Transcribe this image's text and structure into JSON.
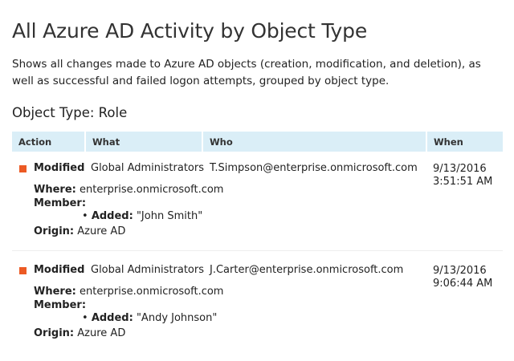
{
  "report": {
    "title": "All Azure AD Activity by Object Type",
    "description": "Shows all changes made to Azure AD objects (creation, modification, and deletion), as well as successful and failed logon attempts, grouped by object type.",
    "section_label": "Object Type: Role"
  },
  "table": {
    "columns": [
      "Action",
      "What",
      "Who",
      "When"
    ],
    "marker_color": "#ec5a24",
    "header_bg": "#daeef7",
    "field_labels": {
      "where": "Where:",
      "member": "Member:",
      "added": "Added:",
      "origin": "Origin:",
      "bullet": "•"
    },
    "rows": [
      {
        "action": "Modified",
        "what": "Global Administrators",
        "who": "T.Simpson@enterprise.onmicrosoft.com",
        "when_date": "9/13/2016",
        "when_time": "3:51:51 AM",
        "where": "enterprise.onmicrosoft.com",
        "added": "\"John Smith\"",
        "origin": "Azure AD"
      },
      {
        "action": "Modified",
        "what": "Global Administrators",
        "who": "J.Carter@enterprise.onmicrosoft.com",
        "when_date": "9/13/2016",
        "when_time": "9:06:44 AM",
        "where": "enterprise.onmicrosoft.com",
        "added": "\"Andy Johnson\"",
        "origin": "Azure AD"
      }
    ]
  }
}
